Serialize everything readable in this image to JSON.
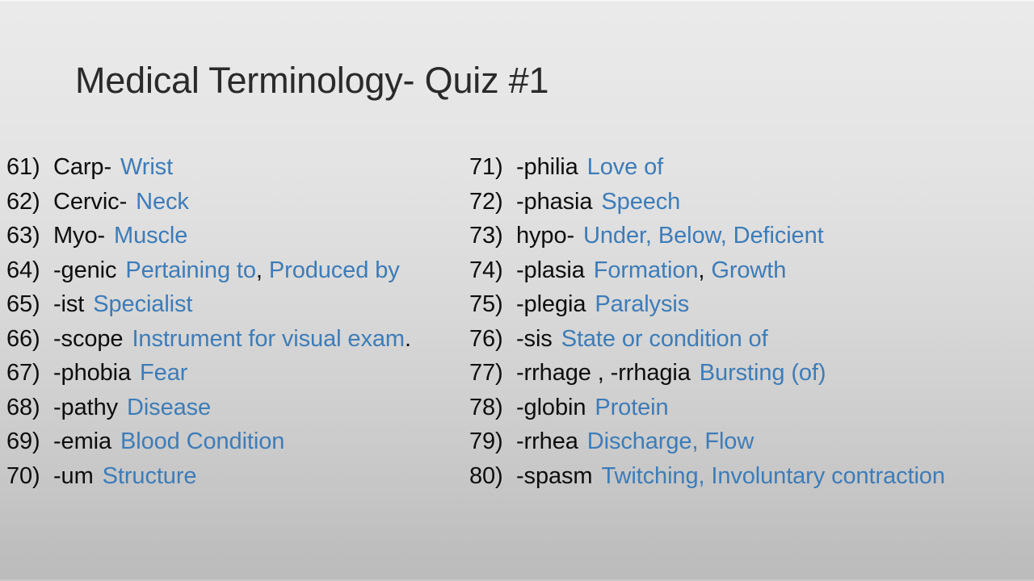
{
  "slide": {
    "title": "Medical Terminology- Quiz #1",
    "background_top_color": "#e8e8e8",
    "background_bottom_color": "#bdbdbd",
    "term_color": "#0d0d0d",
    "definition_color": "#3d7cb8"
  },
  "left_column": [
    {
      "number": "61)",
      "term": "Carp-",
      "definition": "Wrist"
    },
    {
      "number": "62)",
      "term": "Cervic-",
      "definition": "Neck"
    },
    {
      "number": "63)",
      "term": "Myo-",
      "definition": "Muscle"
    },
    {
      "number": "64)",
      "term": "-genic",
      "definition": "Pertaining to",
      "separator": ",",
      "definition2": "Produced by"
    },
    {
      "number": "65)",
      "term": "-ist",
      "definition": "Specialist"
    },
    {
      "number": "66)",
      "term": "-scope",
      "definition": "Instrument for visual exam",
      "trailing": "."
    },
    {
      "number": "67)",
      "term": "-phobia",
      "definition": "Fear"
    },
    {
      "number": "68)",
      "term": "-pathy",
      "definition": "Disease"
    },
    {
      "number": "69)",
      "term": "-emia",
      "definition": "Blood Condition"
    },
    {
      "number": "70)",
      "term": "-um",
      "definition": "Structure"
    }
  ],
  "right_column": [
    {
      "number": "71)",
      "term": "-philia",
      "definition": "Love of"
    },
    {
      "number": "72)",
      "term": "-phasia",
      "definition": "Speech"
    },
    {
      "number": "73)",
      "term": "hypo-",
      "definition": "Under, Below, Deficient"
    },
    {
      "number": "74)",
      "term": "-plasia",
      "definition": "Formation",
      "separator": ",",
      "definition2": "Growth"
    },
    {
      "number": "75)",
      "term": "-plegia",
      "definition": "Paralysis"
    },
    {
      "number": "76)",
      "term": "-sis",
      "definition": "State or condition of"
    },
    {
      "number": "77)",
      "term": "-rrhage , -rrhagia",
      "definition": "Bursting (of)"
    },
    {
      "number": "78)",
      "term": "-globin",
      "definition": "Protein"
    },
    {
      "number": "79)",
      "term": "-rrhea",
      "definition": "Discharge, Flow"
    },
    {
      "number": "80)",
      "term": "-spasm",
      "definition": "Twitching, Involuntary contraction"
    }
  ]
}
